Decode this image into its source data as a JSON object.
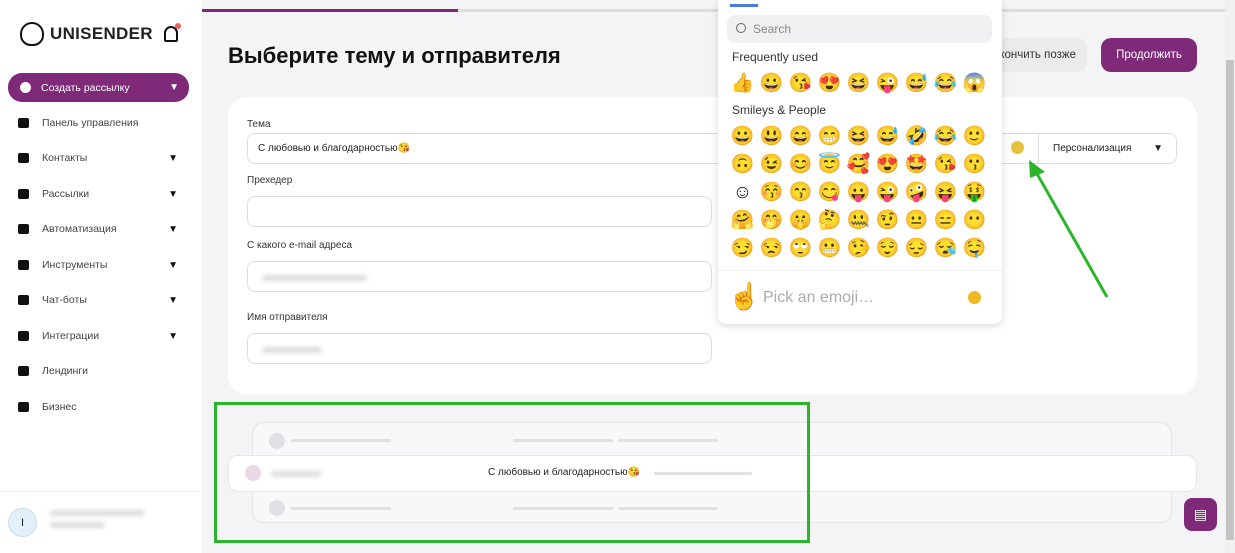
{
  "brand": {
    "name": "UNISENDER"
  },
  "sidebar": {
    "create": "Создать рассылку",
    "items": [
      {
        "label": "Панель управления",
        "icon": "dashboard-icon",
        "chevron": false
      },
      {
        "label": "Контакты",
        "icon": "contacts-icon",
        "chevron": true
      },
      {
        "label": "Рассылки",
        "icon": "mail-icon",
        "chevron": true
      },
      {
        "label": "Автоматизация",
        "icon": "automation-icon",
        "chevron": true
      },
      {
        "label": "Инструменты",
        "icon": "tools-icon",
        "chevron": true
      },
      {
        "label": "Чат-боты",
        "icon": "bot-icon",
        "chevron": true
      },
      {
        "label": "Интеграции",
        "icon": "puzzle-icon",
        "chevron": true
      },
      {
        "label": "Лендинги",
        "icon": "landing-icon",
        "chevron": false
      },
      {
        "label": "Бизнес",
        "icon": "yandex-icon",
        "chevron": false
      }
    ],
    "user_initial": "I"
  },
  "header": {
    "title": "Выберите тему и отправителя",
    "later": "Закончить позже",
    "continue": "Продолжить",
    "progress": 0.25
  },
  "form": {
    "subject_label": "Тема",
    "subject_value": "С любовью и благодарностью😘",
    "preheader_label": "Прехедер",
    "preheader_value": "",
    "email_label": "С какого e-mail адреса",
    "sender_label": "Имя отправителя",
    "personalization": "Персонализация"
  },
  "picker": {
    "search_placeholder": "Search",
    "frequent_label": "Frequently used",
    "frequent": [
      "👍",
      "😀",
      "😘",
      "😍",
      "😆",
      "😜",
      "😅",
      "😂",
      "😱"
    ],
    "smileys_label": "Smileys & People",
    "smileys": [
      [
        "😀",
        "😃",
        "😄",
        "😁",
        "😆",
        "😅",
        "🤣",
        "😂",
        "🙂"
      ],
      [
        "🙃",
        "😉",
        "😊",
        "😇",
        "🥰",
        "😍",
        "🤩",
        "😘",
        "😗"
      ],
      [
        "☺",
        "😚",
        "😙",
        "😋",
        "😛",
        "😜",
        "🤪",
        "😝",
        "🤑"
      ],
      [
        "🤗",
        "🤭",
        "🤫",
        "🤔",
        "🤐",
        "🤨",
        "😐",
        "😑",
        "😶"
      ],
      [
        "😏",
        "😒",
        "🙄",
        "😬",
        "🤥",
        "😌",
        "😔",
        "😪",
        "🤤"
      ]
    ],
    "preview_icon": "☝",
    "pick_placeholder": "Pick an emoji…"
  },
  "preview": {
    "subject": "С любовью и благодарностью😘"
  },
  "colors": {
    "accent": "#7e2a78",
    "annotation": "#2bb52b"
  }
}
